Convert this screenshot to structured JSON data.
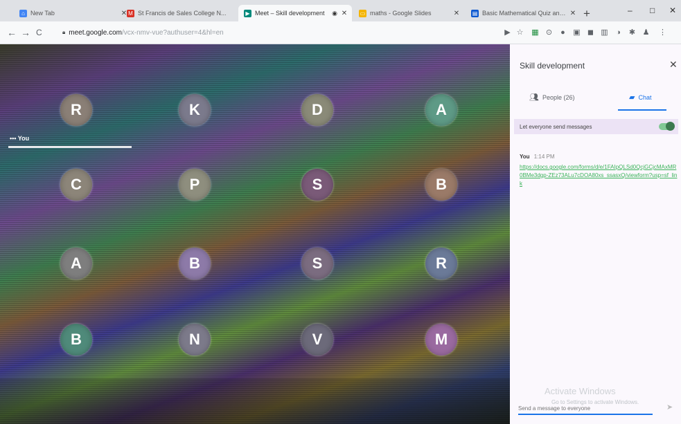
{
  "tabs": [
    {
      "title": "New Tab",
      "fav": "⌂",
      "fav_color": "#4285f4",
      "active": false
    },
    {
      "title": "St Francis de Sales College N...",
      "fav": "M",
      "fav_color": "#d93025",
      "active": false
    },
    {
      "title": "Meet – Skill development",
      "fav": "▶",
      "fav_color": "#00897b",
      "active": true
    },
    {
      "title": "maths - Google Slides",
      "fav": "▭",
      "fav_color": "#f4b400",
      "active": false
    },
    {
      "title": "Basic Mathematical Quiz and ...",
      "fav": "▤",
      "fav_color": "#0b57d0",
      "active": false
    }
  ],
  "window_controls": {
    "minimize": "–",
    "maximize": "□",
    "close": "✕"
  },
  "toolbar": {
    "back": "←",
    "forward": "→",
    "reload": "C",
    "lock": "🔒",
    "url_host": "meet.google.com",
    "url_path": "/vcx-nmv-vue?authuser=4&hl=en"
  },
  "extensions": [
    "▶",
    "☆",
    "▦",
    "⊙",
    "●",
    "▣",
    "◼",
    "▥",
    "◑",
    "✱",
    "♟",
    "⋮"
  ],
  "meeting": {
    "self_label": "You",
    "self_dots": "•••",
    "participants": [
      {
        "initial": "R",
        "color": "#8a7f76"
      },
      {
        "initial": "K",
        "color": "#7b7a8c"
      },
      {
        "initial": "D",
        "color": "#8a8a78"
      },
      {
        "initial": "A",
        "color": "#5e9a86"
      },
      {
        "initial": "C",
        "color": "#8c8579"
      },
      {
        "initial": "P",
        "color": "#8e8e7e"
      },
      {
        "initial": "S",
        "color": "#7a5a78"
      },
      {
        "initial": "B",
        "color": "#9a7a68"
      },
      {
        "initial": "A",
        "color": "#7e7e7e"
      },
      {
        "initial": "B",
        "color": "#8d7aa8"
      },
      {
        "initial": "S",
        "color": "#7b6c80"
      },
      {
        "initial": "R",
        "color": "#6b7a98"
      },
      {
        "initial": "B",
        "color": "#4f8a7a"
      },
      {
        "initial": "N",
        "color": "#7c7a8a"
      },
      {
        "initial": "V",
        "color": "#6c6a7a"
      },
      {
        "initial": "M",
        "color": "#9a6aa0"
      }
    ]
  },
  "panel": {
    "title": "Skill development",
    "close": "✕",
    "people_tab": "People (26)",
    "chat_tab": "Chat",
    "permission_label": "Let everyone send messages",
    "message": {
      "sender": "You",
      "time": "1:14 PM",
      "link": "https://docs.google.com/forms/d/e/1FAIpQLSd0QcjGCjcMAxMR0BMe3dgp-ZEz73ALu7cDOA80xs_ssasxQ/viewform?usp=sf_link"
    },
    "watermark_title": "Activate Windows",
    "watermark_sub": "Go to Settings to activate Windows.",
    "input_placeholder": "Send a message to everyone",
    "send": "➤"
  },
  "colors": {
    "accent": "#1a73e8",
    "link": "#3bb35a",
    "toggle": "#81c995"
  }
}
